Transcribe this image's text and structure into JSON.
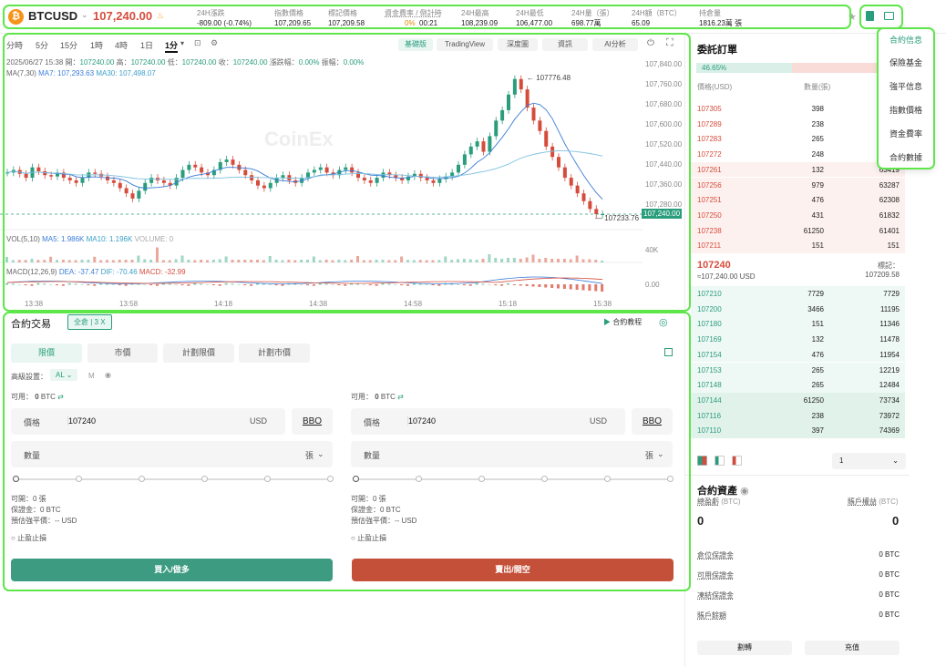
{
  "header": {
    "coin_icon": "₿",
    "symbol": "BTCUSD",
    "price": "107,240.00",
    "stats": [
      {
        "label": "24H漲跌",
        "value": "-809.00 (-0.74%)",
        "color": "red"
      },
      {
        "label": "指數價格",
        "value": "107,209.65"
      },
      {
        "label": "標記價格",
        "value": "107,209.58"
      },
      {
        "label": "資金費率 / 倒計時",
        "value_a": "0%",
        "value_b": "00:21"
      },
      {
        "label": "24H最高",
        "value": "108,239.09"
      },
      {
        "label": "24H最低",
        "value": "106,477.00"
      },
      {
        "label": "24H量（張）",
        "value": "698.77萬"
      },
      {
        "label": "24H額（BTC）",
        "value": "65.09"
      },
      {
        "label": "持倉量",
        "value": "1816.23萬 張"
      }
    ]
  },
  "chart": {
    "timeframes": [
      "分時",
      "5分",
      "15分",
      "1時",
      "4時",
      "1日",
      "1分"
    ],
    "views": [
      "基礎版",
      "TradingView",
      "深度圖",
      "資訊",
      "AI分析"
    ],
    "ohlc_line": {
      "date": "2025/06/27 15:38",
      "open_l": "開：",
      "open": "107240.00",
      "high_l": "高：",
      "high": "107240.00",
      "low_l": "低：",
      "low": "107240.00",
      "close_l": "收：",
      "close": "107240.00",
      "chg_l": "漲跌幅：",
      "chg": "0.00%",
      "amp_l": "振幅：",
      "amp": "0.00%"
    },
    "ma_line": {
      "label": "MA(7,30)",
      "ma7": "MA7: 107,293.63",
      "ma30": "MA30: 107,498.07"
    },
    "vol_line": {
      "label": "VOL(5,10)",
      "ma5": "MA5: 1.986K",
      "ma10": "MA10: 1.196K",
      "vol": "VOLUME: 0"
    },
    "macd_line": {
      "label": "MACD(12,26,9)",
      "dea": "DEA: -37.47",
      "dif": "DIF: -70.46",
      "macd": "MACD: -32.99"
    },
    "watermark": "CoinEx",
    "high_marker": "107776.48",
    "low_marker": "107233.76",
    "last_price": "107,240.00",
    "y_ticks": [
      "107,840.00",
      "107,760.00",
      "107,680.00",
      "107,600.00",
      "107,520.00",
      "107,440.00",
      "107,360.00",
      "107,280.00"
    ],
    "vol_tick": "40K",
    "macd_tick": "0.00",
    "x_ticks": [
      "13:38",
      "13:58",
      "14:18",
      "14:38",
      "14:58",
      "15:18",
      "15:38"
    ]
  },
  "chart_data": {
    "type": "candlestick",
    "x_ticks": [
      "13:38",
      "13:58",
      "14:18",
      "14:38",
      "14:58",
      "15:18",
      "15:38"
    ],
    "ylim": [
      107200,
      107850
    ],
    "last": 107240.0,
    "high": 107776.48,
    "low": 107233.76
  },
  "trade": {
    "title": "合約交易",
    "mode": "全倉 | 3 X",
    "tutorial": "合約教程",
    "tabs": [
      "限價",
      "市價",
      "計劃限價",
      "計劃市價"
    ],
    "adv_label": "高級設置：",
    "adv_value": "AL",
    "adv_m": "M",
    "avail_l": "可用：",
    "avail_v": "0",
    "avail_u": "BTC",
    "price_l": "價格",
    "price_v": "107240",
    "price_u": "USD",
    "bbo": "BBO",
    "qty_l": "數量",
    "qty_u": "張",
    "open_l": "可開：",
    "open_v": "0 張",
    "margin_l": "保證金：",
    "margin_v": "0 BTC",
    "liq_l": "預估強平價：",
    "liq_v": "-- USD",
    "tpsl": "止盈止損",
    "buy": "買入/做多",
    "sell": "賣出/開空"
  },
  "orderbook": {
    "title": "委託訂單",
    "buy_pct": "46.65%",
    "sell_pct": "53",
    "headers": [
      "價格(USD)",
      "數量(張)"
    ],
    "asks": [
      [
        "107305",
        "398",
        ""
      ],
      [
        "107289",
        "238",
        ""
      ],
      [
        "107283",
        "265",
        ""
      ],
      [
        "107272",
        "248",
        ""
      ],
      [
        "107261",
        "132",
        "63419"
      ],
      [
        "107256",
        "979",
        "63287"
      ],
      [
        "107251",
        "476",
        "62308"
      ],
      [
        "107250",
        "431",
        "61832"
      ],
      [
        "107238",
        "61250",
        "61401"
      ],
      [
        "107211",
        "151",
        "151"
      ]
    ],
    "mid": "107240",
    "mid_sub": "≈107,240.00  USD",
    "mark_l": "標記：",
    "mark_v": "107209.58",
    "bids": [
      [
        "107210",
        "7729",
        "7729"
      ],
      [
        "107200",
        "3466",
        "11195"
      ],
      [
        "107180",
        "151",
        "11346"
      ],
      [
        "107169",
        "132",
        "11478"
      ],
      [
        "107154",
        "476",
        "11954"
      ],
      [
        "107153",
        "265",
        "12219"
      ],
      [
        "107148",
        "265",
        "12484"
      ],
      [
        "107144",
        "61250",
        "73734"
      ],
      [
        "107116",
        "238",
        "73972"
      ],
      [
        "107110",
        "397",
        "74369"
      ]
    ],
    "depth": "1"
  },
  "assets": {
    "title": "合約資產",
    "pnl_l": "總盈虧",
    "pnl_u": "(BTC)",
    "eq_l": "賬戶權益",
    "eq_u": "(BTC)",
    "pnl_v": "0",
    "eq_v": "0",
    "rows": [
      [
        "倉位保證金",
        "0 BTC"
      ],
      [
        "可用保證金",
        "0 BTC"
      ],
      [
        "凍結保證金",
        "0 BTC"
      ],
      [
        "賬戶餘額",
        "0 BTC"
      ]
    ],
    "transfer": "劃轉",
    "deposit": "充值"
  },
  "menu": {
    "items": [
      "合約信息",
      "保險基金",
      "強平信息",
      "指數價格",
      "資金費率",
      "合約數據"
    ]
  }
}
